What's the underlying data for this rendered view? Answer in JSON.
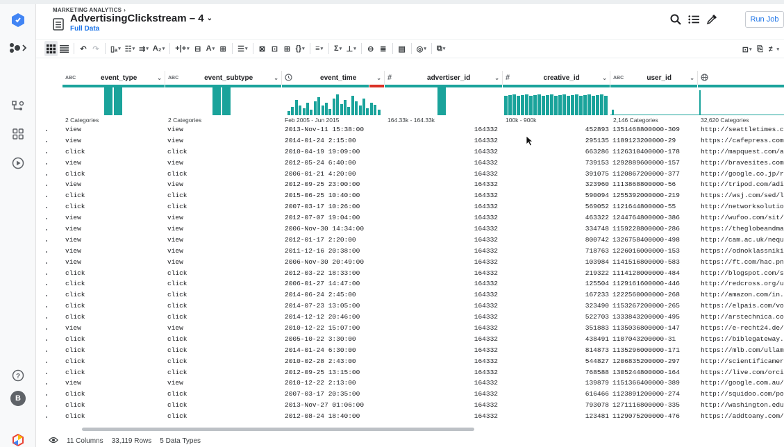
{
  "header": {
    "breadcrumb": "MARKETING ANALYTICS",
    "title": "AdvertisingClickstream – 4",
    "subtitle": "Full Data",
    "run_button": "Run Job"
  },
  "toolbar": {
    "items": [
      "grid-view",
      "list-view",
      "undo",
      "redo",
      "rename",
      "filter",
      "merge",
      "text-format",
      "split",
      "columns",
      "text",
      "format",
      "move",
      "nest",
      "unnest",
      "pivot",
      "json",
      "functions",
      "sum",
      "join",
      "union",
      "comment",
      "target",
      "copy"
    ]
  },
  "columns": [
    {
      "type": "ABC",
      "name": "event_type",
      "summary": "2 Categories"
    },
    {
      "type": "ABC",
      "name": "event_subtype",
      "summary": "2 Categories"
    },
    {
      "type": "clock-icon",
      "name": "event_time",
      "summary": "Feb 2005 - Jun 2015"
    },
    {
      "type": "#",
      "name": "advertiser_id",
      "summary": "164.33k - 164.33k"
    },
    {
      "type": "#",
      "name": "creative_id",
      "summary": "100k - 900k"
    },
    {
      "type": "ABC",
      "name": "user_id",
      "summary": "2,146 Categories"
    },
    {
      "type": "globe-icon",
      "name": "",
      "summary": "32,620 Categories"
    }
  ],
  "rows": [
    [
      "view",
      "view",
      "2013-Nov-11 15:38:00",
      "164332",
      "452893",
      "1351468800000-309",
      "http://seattletimes.c"
    ],
    [
      "view",
      "view",
      "2014-01-24 2:15:00",
      "164332",
      "295135",
      "1189123200000-29",
      "https://cafepress.com"
    ],
    [
      "click",
      "click",
      "2010-04-19 19:09:00",
      "164332",
      "663286",
      "1126310400000-178",
      "http://mapquest.com/a"
    ],
    [
      "view",
      "view",
      "2012-05-24 6:40:00",
      "164332",
      "739153",
      "1292889600000-157",
      "http://bravesites.com"
    ],
    [
      "click",
      "click",
      "2006-01-21 4:20:00",
      "164332",
      "391075",
      "1120867200000-377",
      "http://google.co.jp/r"
    ],
    [
      "view",
      "view",
      "2012-09-25 23:00:00",
      "164332",
      "323960",
      "1113868800000-56",
      "http://tripod.com/adi"
    ],
    [
      "click",
      "click",
      "2015-06-25 10:40:00",
      "164332",
      "590094",
      "1255392000000-219",
      "https://wsj.com/sed/l"
    ],
    [
      "click",
      "click",
      "2007-03-17 10:26:00",
      "164332",
      "569052",
      "1121644800000-55",
      "http://networksolutio"
    ],
    [
      "view",
      "view",
      "2012-07-07 19:04:00",
      "164332",
      "463322",
      "1244764800000-386",
      "http://wufoo.com/sit/"
    ],
    [
      "view",
      "view",
      "2006-Nov-30 14:34:00",
      "164332",
      "334748",
      "1159228800000-286",
      "https://theglobeandma"
    ],
    [
      "view",
      "view",
      "2012-01-17 2:20:00",
      "164332",
      "800742",
      "1326758400000-498",
      "http://cam.ac.uk/nequ"
    ],
    [
      "view",
      "view",
      "2011-12-16 20:38:00",
      "164332",
      "718763",
      "1226016000000-153",
      "https://odnoklassniki"
    ],
    [
      "view",
      "view",
      "2006-Nov-30 20:49:00",
      "164332",
      "103984",
      "1141516800000-583",
      "https://ft.com/hac.pn"
    ],
    [
      "click",
      "click",
      "2012-03-22 18:33:00",
      "164332",
      "219322",
      "1114128000000-484",
      "http://blogspot.com/s"
    ],
    [
      "click",
      "click",
      "2006-01-27 14:47:00",
      "164332",
      "125504",
      "1129161600000-446",
      "http://redcross.org/u"
    ],
    [
      "click",
      "click",
      "2014-06-24 2:45:00",
      "164332",
      "167233",
      "1222560000000-268",
      "http://amazon.com/in."
    ],
    [
      "click",
      "click",
      "2014-07-23 13:05:00",
      "164332",
      "323490",
      "1153267200000-265",
      "https://elpais.com/vo"
    ],
    [
      "click",
      "click",
      "2014-12-12 20:46:00",
      "164332",
      "522703",
      "1333843200000-495",
      "http://arstechnica.co"
    ],
    [
      "view",
      "view",
      "2010-12-22 15:07:00",
      "164332",
      "351883",
      "1135036800000-147",
      "https://e-recht24.de/"
    ],
    [
      "click",
      "click",
      "2005-10-22 3:30:00",
      "164332",
      "438491",
      "1107043200000-31",
      "https://biblegateway."
    ],
    [
      "click",
      "click",
      "2014-01-24 6:30:00",
      "164332",
      "814873",
      "1135296000000-171",
      "https://mlb.com/ullamc"
    ],
    [
      "click",
      "click",
      "2010-02-28 2:43:00",
      "164332",
      "544827",
      "1206835200000-297",
      "http://scientificamer"
    ],
    [
      "click",
      "click",
      "2012-09-25 13:15:00",
      "164332",
      "768588",
      "1305244800000-164",
      "https://live.com/orci"
    ],
    [
      "view",
      "view",
      "2010-12-22 2:13:00",
      "164332",
      "139879",
      "1151366400000-389",
      "http://google.com.au/"
    ],
    [
      "click",
      "click",
      "2007-03-17 20:35:00",
      "164332",
      "616466",
      "1123891200000-274",
      "http://squidoo.com/po"
    ],
    [
      "click",
      "click",
      "2013-Nov-27 01:06:00",
      "164332",
      "793078",
      "1271116800000-335",
      "http://washington.edu"
    ],
    [
      "click",
      "click",
      "2012-08-24 18:40:00",
      "164332",
      "123481",
      "1129075200000-476",
      "https://addtoany.com/"
    ]
  ],
  "footer": {
    "columns": "11 Columns",
    "rows": "33,119 Rows",
    "types": "5 Data Types"
  },
  "user": {
    "initial": "B"
  },
  "colors": {
    "accent": "#1a73e8",
    "bar": "#1aa39b",
    "error": "#d93025"
  }
}
